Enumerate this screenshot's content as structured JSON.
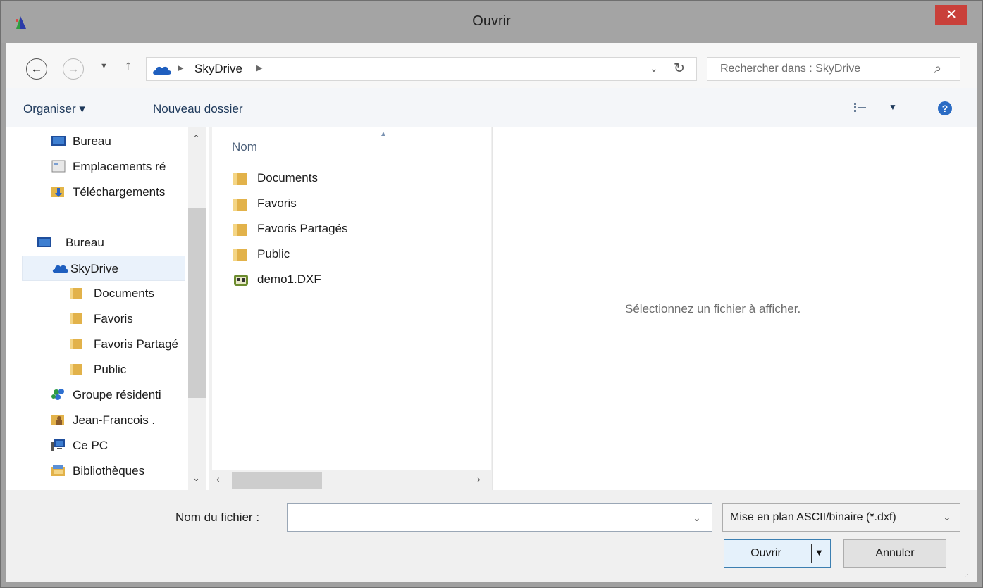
{
  "window": {
    "title": "Ouvrir",
    "close_label": "✕",
    "colors": {
      "close_button": "#c9403a",
      "title_bar": "#a4a4a4"
    }
  },
  "address_bar": {
    "breadcrumb": [
      "SkyDrive"
    ],
    "refresh_glyph": "↻",
    "dropdown_glyph": "⌄"
  },
  "search": {
    "placeholder": "Rechercher dans : SkyDrive"
  },
  "toolbar": {
    "organize_label": "Organiser ▾",
    "new_folder_label": "Nouveau dossier",
    "view_dropdown": "▼",
    "help": "?"
  },
  "nav_pane": {
    "items": [
      {
        "label": "Bureau",
        "icon": "desktop-icon"
      },
      {
        "label": "Emplacements ré",
        "icon": "recent-places-icon"
      },
      {
        "label": "Téléchargements",
        "icon": "downloads-icon"
      },
      {
        "label": "Bureau",
        "icon": "desktop-icon"
      },
      {
        "label": "SkyDrive",
        "icon": "skydrive-icon",
        "selected": true
      },
      {
        "label": "Documents",
        "icon": "folder-icon"
      },
      {
        "label": "Favoris",
        "icon": "folder-icon"
      },
      {
        "label": "Favoris Partagé",
        "icon": "folder-icon"
      },
      {
        "label": "Public",
        "icon": "folder-icon"
      },
      {
        "label": "Groupe résidenti",
        "icon": "homegroup-icon"
      },
      {
        "label": "Jean-Francois .",
        "icon": "user-folder-icon"
      },
      {
        "label": "Ce PC",
        "icon": "computer-icon"
      },
      {
        "label": "Bibliothèques",
        "icon": "libraries-icon"
      }
    ]
  },
  "file_list": {
    "column_name": "Nom",
    "files": [
      {
        "name": "Documents",
        "icon": "folder-icon"
      },
      {
        "name": "Favoris",
        "icon": "folder-icon"
      },
      {
        "name": "Favoris Partagés",
        "icon": "folder-icon"
      },
      {
        "name": "Public",
        "icon": "folder-icon"
      },
      {
        "name": "demo1.DXF",
        "icon": "dxf-file-icon"
      }
    ]
  },
  "preview": {
    "message": "Sélectionnez un fichier à afficher."
  },
  "footer": {
    "filename_label": "Nom du fichier :",
    "filename_value": "",
    "filetype_value": "Mise en plan ASCII/binaire (*.dxf)",
    "open_label": "Ouvrir",
    "cancel_label": "Annuler"
  }
}
